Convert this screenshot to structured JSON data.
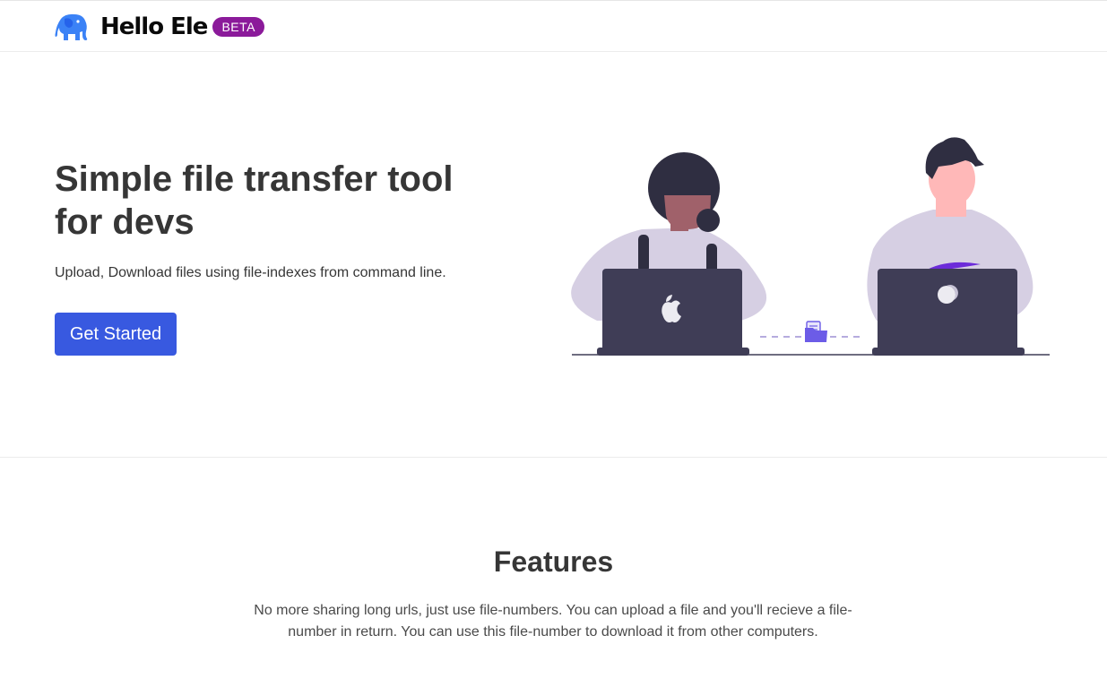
{
  "header": {
    "brand_name": "Hello Ele",
    "badge": "BETA",
    "logo_icon": "elephant-icon",
    "brand_color": "#3b82f6",
    "badge_color": "#8b1a9a"
  },
  "hero": {
    "title": "Simple file transfer tool for devs",
    "subtitle": "Upload, Download files using file-indexes from command line.",
    "cta_label": "Get Started",
    "cta_color": "#3859e0",
    "illustration": "two-developers-file-transfer-illustration"
  },
  "features": {
    "title": "Features",
    "description": "No more sharing long urls, just use file-numbers. You can upload a file and you'll recieve a file-number in return. You can use this file-number to download it from other computers."
  }
}
